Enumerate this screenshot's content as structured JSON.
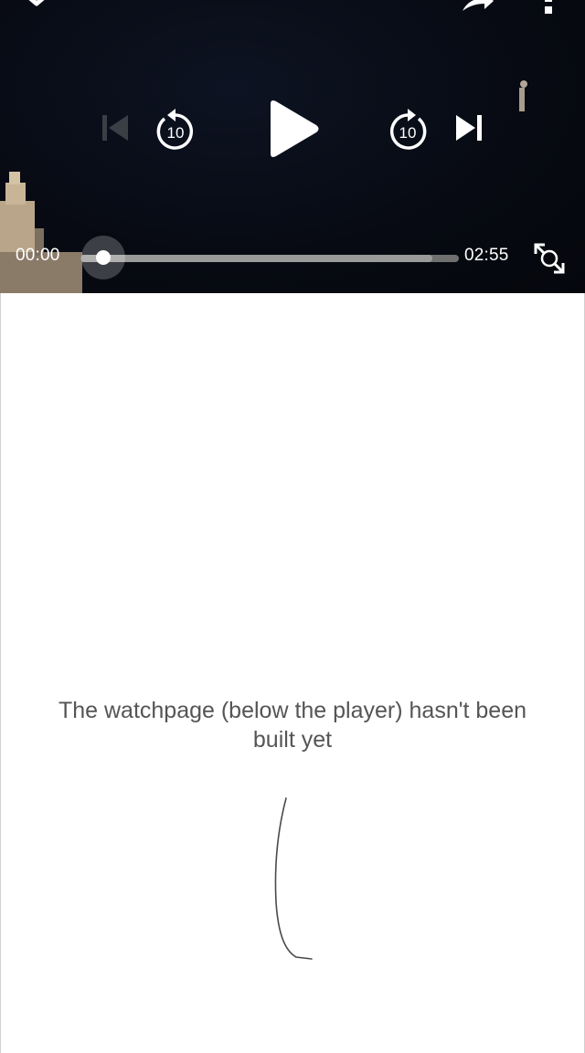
{
  "player": {
    "current_time": "00:00",
    "duration": "02:55",
    "progress": 0.0,
    "buffered_fraction": 0.93,
    "icons": {
      "collapse": "chevron-down-icon",
      "share": "share-icon",
      "more": "more-vert-icon",
      "previous": "skip-previous-icon",
      "rewind": "replay-10-icon",
      "play": "play-icon",
      "forward": "forward-10-icon",
      "next": "skip-next-icon",
      "fullscreen": "fullscreen-icon"
    },
    "rewind_label": "10",
    "forward_label": "10"
  },
  "watchpage": {
    "message": "The watchpage (below the player) hasn't been built yet"
  }
}
